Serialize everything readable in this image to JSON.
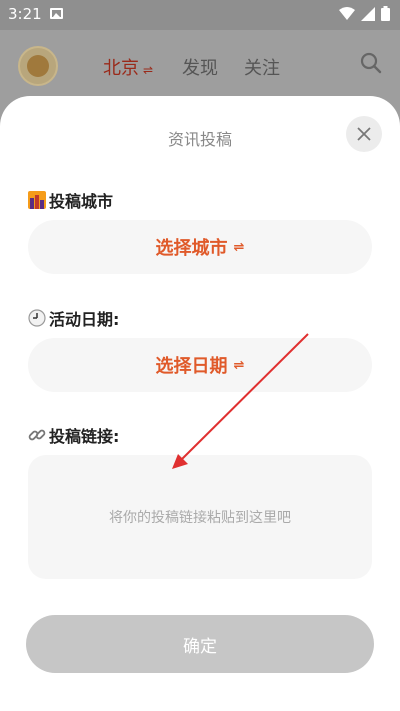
{
  "status_bar": {
    "time": "3:21"
  },
  "app_bar": {
    "city_tab": "北京",
    "swap_symbol": "⇌",
    "discover_tab": "发现",
    "follow_tab": "关注"
  },
  "sheet": {
    "title": "资讯投稿",
    "city_label": "投稿城市",
    "city_select": "选择城市",
    "date_label": "活动日期:",
    "date_select": "选择日期",
    "link_label": "投稿链接:",
    "link_placeholder": "将你的投稿链接粘贴到这里吧",
    "confirm_label": "确定"
  },
  "colors": {
    "accent": "#e05a2a",
    "city_tab": "#9a2a1a",
    "annotation_arrow": "#e03030"
  }
}
